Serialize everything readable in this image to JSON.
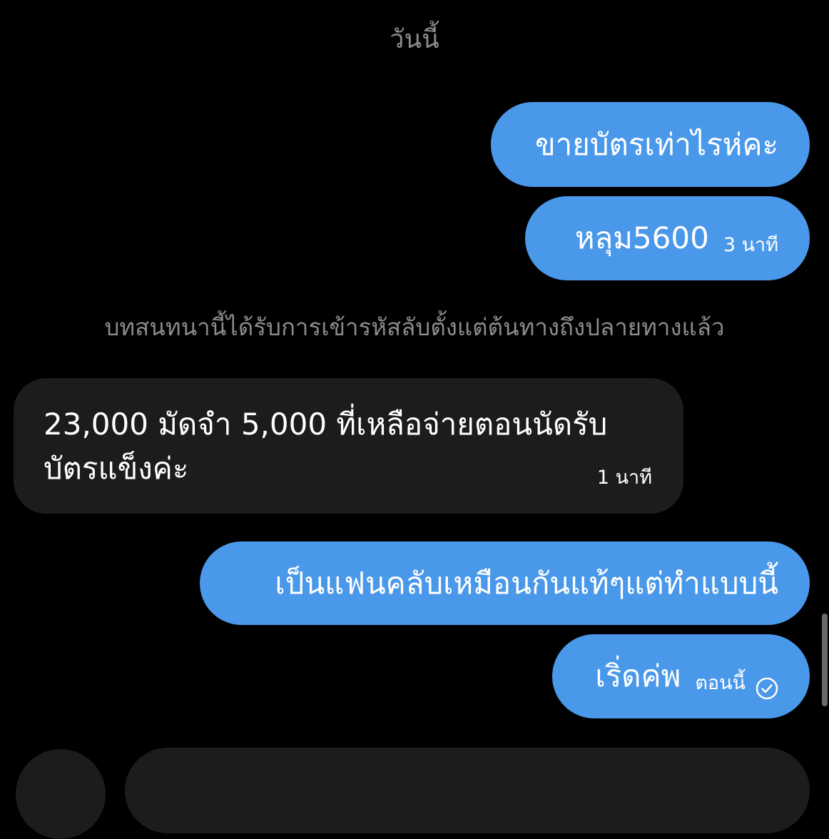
{
  "date_separator": "วันนี้",
  "encryption_notice": "บทสนทนานี้ได้รับการเข้ารหัสลับตั้งแต่ต้นทางถึงปลายทางแล้ว",
  "messages": [
    {
      "direction": "outgoing",
      "text": "ขายบัตรเท่าไรห่คะ",
      "time": ""
    },
    {
      "direction": "outgoing",
      "text": "หลุม5600",
      "time": "3 นาที"
    },
    {
      "direction": "incoming",
      "line1": "23,000 มัดจำ 5,000 ที่เหลือจ่ายตอนนัดรับ",
      "line2": "บัตรแข็งค่ะ",
      "time": "1 นาที"
    },
    {
      "direction": "outgoing",
      "text": "เป็นแฟนคลับเหมือนกันแท้ๆแต่ทำแบบนี้",
      "time": ""
    },
    {
      "direction": "outgoing",
      "text": "เริ่ดค่พ",
      "time": "ตอนนี้",
      "status_icon": "check-circle-icon"
    }
  ],
  "colors": {
    "background": "#000000",
    "outgoing_bubble": "#4a98e9",
    "incoming_bubble": "#1c1c1e",
    "muted_text": "#8b8b8f"
  }
}
